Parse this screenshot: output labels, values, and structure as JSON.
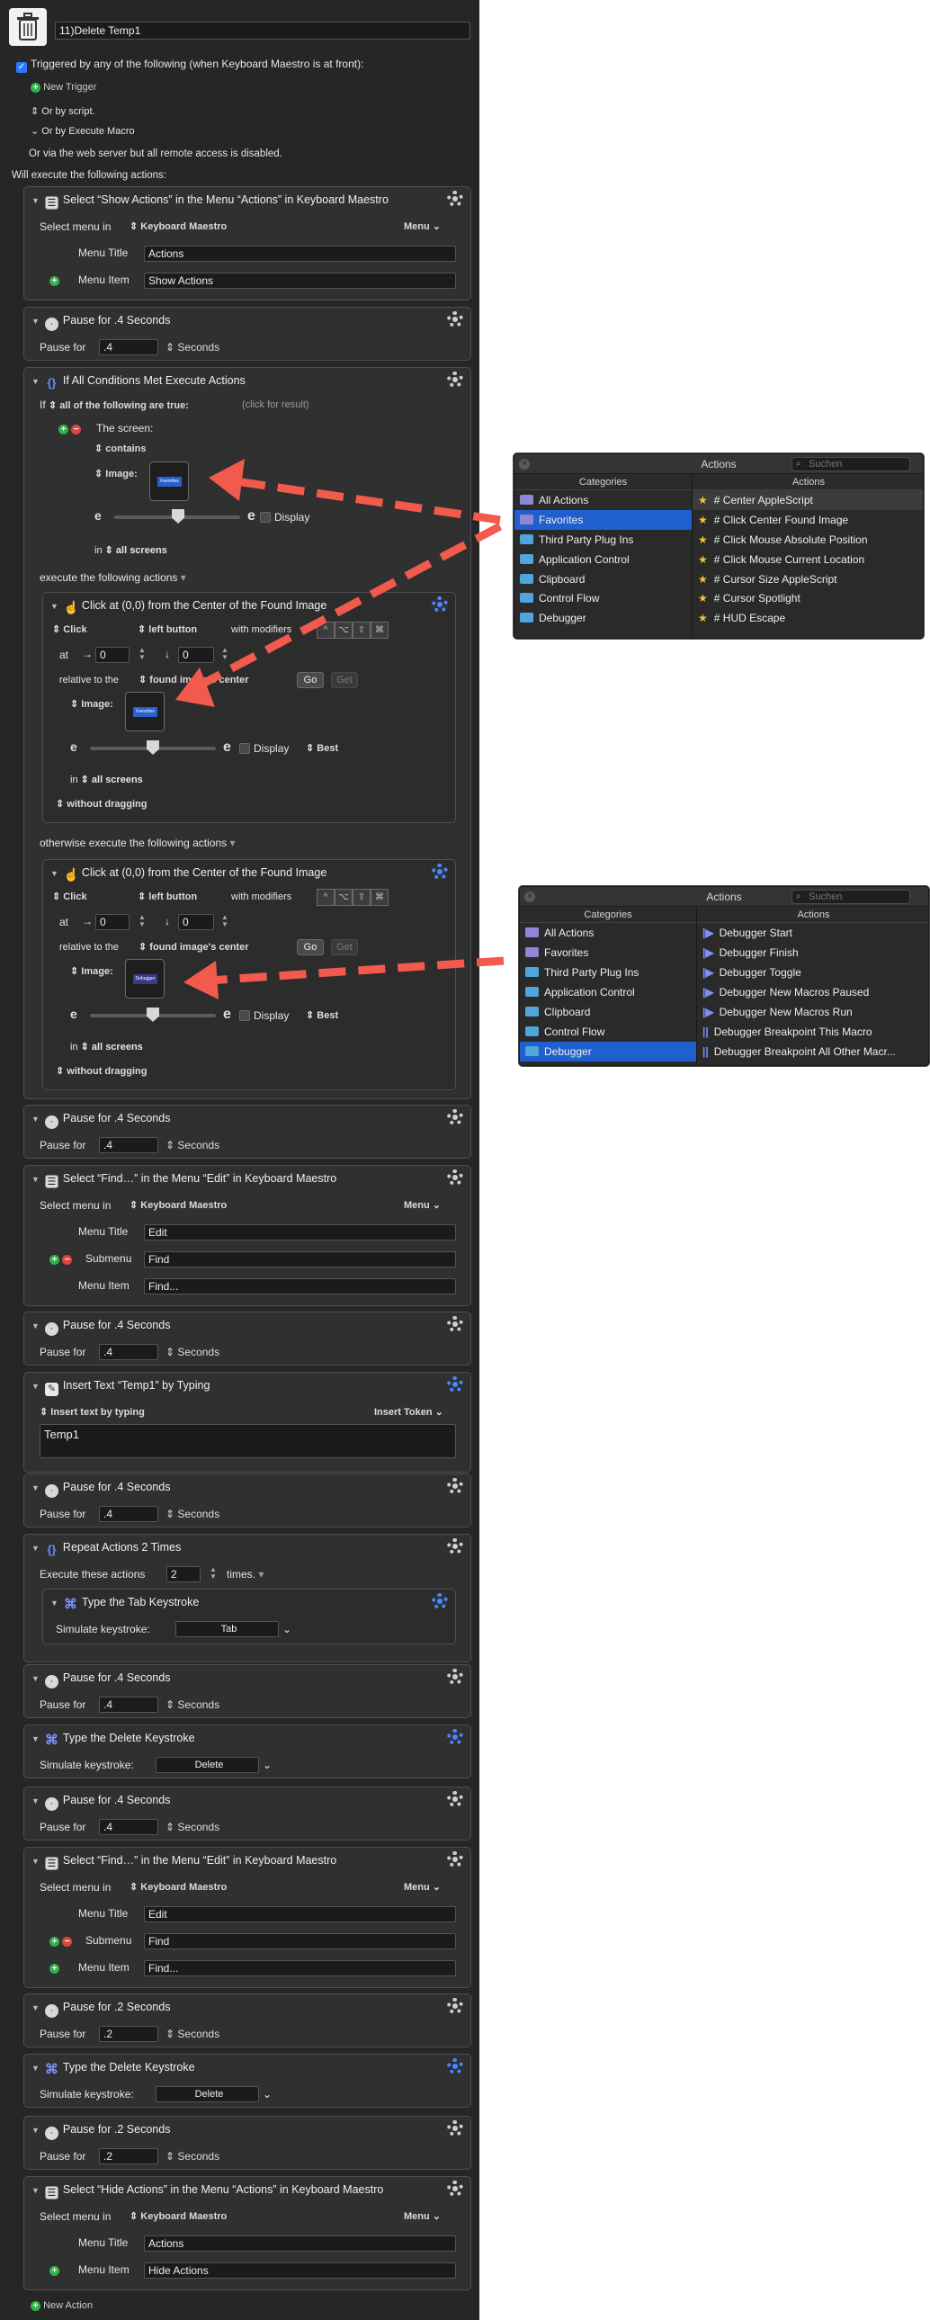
{
  "macro": {
    "title": "11)Delete Temp1"
  },
  "triggers": {
    "header": "Triggered by any of the following (when Keyboard Maestro is at front):",
    "new_trigger": "New Trigger",
    "or_by_script": "Or by script.",
    "or_by_execute": "Or by Execute Macro",
    "web_server": "Or via the web server but all remote access is disabled.",
    "will_execute": "Will execute the following actions:"
  },
  "actions": {
    "a1": {
      "title": "Select “Show Actions” in the Menu “Actions” in Keyboard Maestro",
      "select_menu_in": "Select menu in",
      "app": "Keyboard Maestro",
      "menu_btn": "Menu",
      "menu_title_label": "Menu Title",
      "menu_title": "Actions",
      "menu_item_label": "Menu Item",
      "menu_item": "Show Actions"
    },
    "a2": {
      "title": "Pause for .4 Seconds",
      "pause_label": "Pause for",
      "value": ".4",
      "unit": "Seconds"
    },
    "a3": {
      "title": "If All Conditions Met Execute Actions",
      "if": "If",
      "all_of": "all of the following are true:",
      "click_result": "(click for result)",
      "screen": "The screen:",
      "contains": "contains",
      "image": "Image:",
      "display": "Display",
      "in": "in",
      "all_screens": "all screens",
      "execute_following": "execute the following actions",
      "otherwise": "otherwise execute the following actions"
    },
    "c1": {
      "title": "Click at (0,0) from the Center of the Found Image",
      "click": "Click",
      "button": "left button",
      "with_modifiers": "with modifiers",
      "at": "at",
      "x": "0",
      "y": "0",
      "relative": "relative to the",
      "relative_value": "found image's center",
      "go": "Go",
      "get": "Get",
      "image": "Image:",
      "display": "Display",
      "best": "Best",
      "in": "in",
      "all_screens": "all screens",
      "without_dragging": "without dragging"
    },
    "c2": {
      "title": "Click at (0,0) from the Center of the Found Image",
      "click": "Click",
      "button": "left button",
      "with_modifiers": "with modifiers",
      "at": "at",
      "x": "0",
      "y": "0",
      "relative": "relative to the",
      "relative_value": "found image's center",
      "go": "Go",
      "get": "Get",
      "image": "Image:",
      "display": "Display",
      "best": "Best",
      "in": "in",
      "all_screens": "all screens",
      "without_dragging": "without dragging"
    },
    "a4": {
      "title": "Pause for .4 Seconds",
      "pause_label": "Pause for",
      "value": ".4",
      "unit": "Seconds"
    },
    "a5": {
      "title": "Select “Find…” in the Menu “Edit” in Keyboard Maestro",
      "select_menu_in": "Select menu in",
      "app": "Keyboard Maestro",
      "menu_btn": "Menu",
      "menu_title_label": "Menu Title",
      "menu_title": "Edit",
      "submenu_label": "Submenu",
      "submenu": "Find",
      "menu_item_label": "Menu Item",
      "menu_item": "Find..."
    },
    "a6": {
      "title": "Pause for .4 Seconds",
      "pause_label": "Pause for",
      "value": ".4",
      "unit": "Seconds"
    },
    "a7": {
      "title": "Insert Text “Temp1” by Typing",
      "insert_by": "Insert text by typing",
      "insert_token": "Insert Token",
      "text": "Temp1"
    },
    "a8": {
      "title": "Pause for .4 Seconds",
      "pause_label": "Pause for",
      "value": ".4",
      "unit": "Seconds"
    },
    "a9": {
      "title": "Repeat Actions 2 Times",
      "execute_these": "Execute these actions",
      "count": "2",
      "times": "times."
    },
    "a9i": {
      "title": "Type the Tab Keystroke",
      "simulate": "Simulate keystroke:",
      "key": "Tab"
    },
    "a10": {
      "title": "Pause for .4 Seconds",
      "pause_label": "Pause for",
      "value": ".4",
      "unit": "Seconds"
    },
    "a11": {
      "title": "Type the Delete Keystroke",
      "simulate": "Simulate keystroke:",
      "key": "Delete"
    },
    "a12": {
      "title": "Pause for .4 Seconds",
      "pause_label": "Pause for",
      "value": ".4",
      "unit": "Seconds"
    },
    "a13": {
      "title": "Select “Find…” in the Menu “Edit” in Keyboard Maestro",
      "select_menu_in": "Select menu in",
      "app": "Keyboard Maestro",
      "menu_btn": "Menu",
      "menu_title_label": "Menu Title",
      "menu_title": "Edit",
      "submenu_label": "Submenu",
      "submenu": "Find",
      "menu_item_label": "Menu Item",
      "menu_item": "Find..."
    },
    "a14": {
      "title": "Pause for .2 Seconds",
      "pause_label": "Pause for",
      "value": ".2",
      "unit": "Seconds"
    },
    "a15": {
      "title": "Type the Delete Keystroke",
      "simulate": "Simulate keystroke:",
      "key": "Delete"
    },
    "a16": {
      "title": "Pause for .2 Seconds",
      "pause_label": "Pause for",
      "value": ".2",
      "unit": "Seconds"
    },
    "a17": {
      "title": "Select “Hide Actions” in the Menu “Actions” in Keyboard Maestro",
      "select_menu_in": "Select menu in",
      "app": "Keyboard Maestro",
      "menu_btn": "Menu",
      "menu_title_label": "Menu Title",
      "menu_title": "Actions",
      "menu_item_label": "Menu Item",
      "menu_item": "Hide Actions"
    }
  },
  "new_action": "New Action",
  "thumb_label": "Favorites",
  "thumb_label2": "Debugger",
  "panel1": {
    "title": "Actions",
    "search_placeholder": "Suchen",
    "col_categories": "Categories",
    "col_actions": "Actions",
    "categories": [
      "All Actions",
      "Favorites",
      "Third Party Plug Ins",
      "Application Control",
      "Clipboard",
      "Control Flow",
      "Debugger"
    ],
    "actions": [
      "# Center AppleScript",
      "# Click Center Found Image",
      "# Click Mouse Absolute Position",
      "# Click Mouse Current Location",
      "# Cursor Size AppleScript",
      "# Cursor Spotlight",
      "# HUD Escape"
    ]
  },
  "panel2": {
    "title": "Actions",
    "search_placeholder": "Suchen",
    "col_categories": "Categories",
    "col_actions": "Actions",
    "categories": [
      "All Actions",
      "Favorites",
      "Third Party Plug Ins",
      "Application Control",
      "Clipboard",
      "Control Flow",
      "Debugger"
    ],
    "actions": [
      "Debugger Start",
      "Debugger Finish",
      "Debugger Toggle",
      "Debugger New Macros Paused",
      "Debugger New Macros Run",
      "Debugger Breakpoint This Macro",
      "Debugger Breakpoint All Other Macr..."
    ]
  },
  "colors": {
    "arrow": "#f25a4e",
    "selection": "#1f5fce",
    "background": "#262626"
  }
}
